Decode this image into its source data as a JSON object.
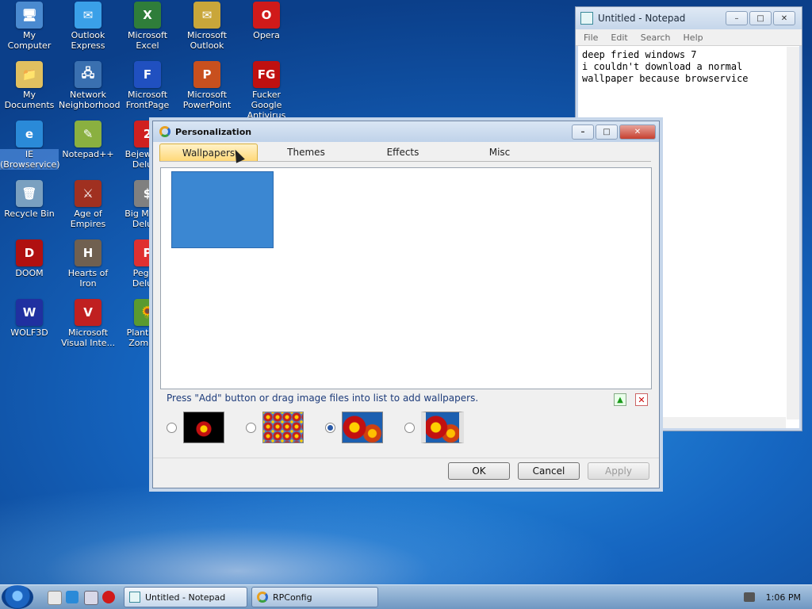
{
  "desktop_icons": [
    {
      "id": "my-computer",
      "label": "My Computer",
      "color": "#4a8ad0",
      "glyph": "🖥"
    },
    {
      "id": "outlook-express",
      "label": "Outlook Express",
      "color": "#3aa0e8",
      "glyph": "✉"
    },
    {
      "id": "excel",
      "label": "Microsoft Excel",
      "color": "#2f7d3a",
      "glyph": "X"
    },
    {
      "id": "outlook",
      "label": "Microsoft Outlook",
      "color": "#c9a63a",
      "glyph": "✉"
    },
    {
      "id": "opera",
      "label": "Opera",
      "color": "#d01a1a",
      "glyph": "O"
    },
    {
      "id": "my-documents",
      "label": "My Documents",
      "color": "#e0c060",
      "glyph": "📁"
    },
    {
      "id": "network",
      "label": "Network Neighborhood",
      "color": "#3a70b0",
      "glyph": "🖧"
    },
    {
      "id": "frontpage",
      "label": "Microsoft FrontPage",
      "color": "#2050c0",
      "glyph": "F"
    },
    {
      "id": "powerpoint",
      "label": "Microsoft PowerPoint",
      "color": "#c8501e",
      "glyph": "P"
    },
    {
      "id": "antivirus",
      "label": "Fucker Google Antivirus 2010",
      "color": "#c01010",
      "glyph": "FG"
    },
    {
      "id": "ie",
      "label": "IE (Browservice)",
      "color": "#2a8ad8",
      "glyph": "e"
    },
    {
      "id": "notepadpp",
      "label": "Notepad++",
      "color": "#8ab040",
      "glyph": "✎"
    },
    {
      "id": "bejeweled",
      "label": "Bejeweled Deluxe",
      "color": "#d02020",
      "glyph": "2"
    },
    {
      "id": "recycle-bin",
      "label": "Recycle Bin",
      "color": "#7aa0c0",
      "glyph": "🗑"
    },
    {
      "id": "aoe",
      "label": "Age of Empires",
      "color": "#a03020",
      "glyph": "⚔"
    },
    {
      "id": "big-money",
      "label": "Big Money Deluxe",
      "color": "#808080",
      "glyph": "$"
    },
    {
      "id": "doom",
      "label": "DOOM",
      "color": "#b01010",
      "glyph": "D"
    },
    {
      "id": "hoi",
      "label": "Hearts of Iron",
      "color": "#706050",
      "glyph": "H"
    },
    {
      "id": "peggle",
      "label": "Peggle Deluxe",
      "color": "#e03030",
      "glyph": "P"
    },
    {
      "id": "wolf3d",
      "label": "WOLF3D",
      "color": "#2030a0",
      "glyph": "W"
    },
    {
      "id": "visual-interdev",
      "label": "Microsoft Visual Inte...",
      "color": "#c02020",
      "glyph": "V"
    },
    {
      "id": "pvz",
      "label": "Plants vs. Zombies",
      "color": "#5a9a30",
      "glyph": "🌻"
    }
  ],
  "notepad": {
    "title": "Untitled - Notepad",
    "menu": [
      "File",
      "Edit",
      "Search",
      "Help"
    ],
    "text": "deep fried windows 7\ni couldn't download a normal\nwallpaper because browservice"
  },
  "dialog": {
    "title": "Personalization",
    "tabs": [
      "Wallpapers",
      "Themes",
      "Effects",
      "Misc"
    ],
    "active_tab": "Wallpapers",
    "hint": "Press \"Add\" button or drag image files into list to add wallpapers.",
    "wallpaper_color": "#3b87d2",
    "selected_style": 3,
    "buttons": {
      "ok": "OK",
      "cancel": "Cancel",
      "apply": "Apply"
    }
  },
  "taskbar": {
    "items": [
      {
        "label": "Untitled - Notepad",
        "active": true
      },
      {
        "label": "RPConfig",
        "active": false
      }
    ],
    "clock": "1:06 PM"
  }
}
